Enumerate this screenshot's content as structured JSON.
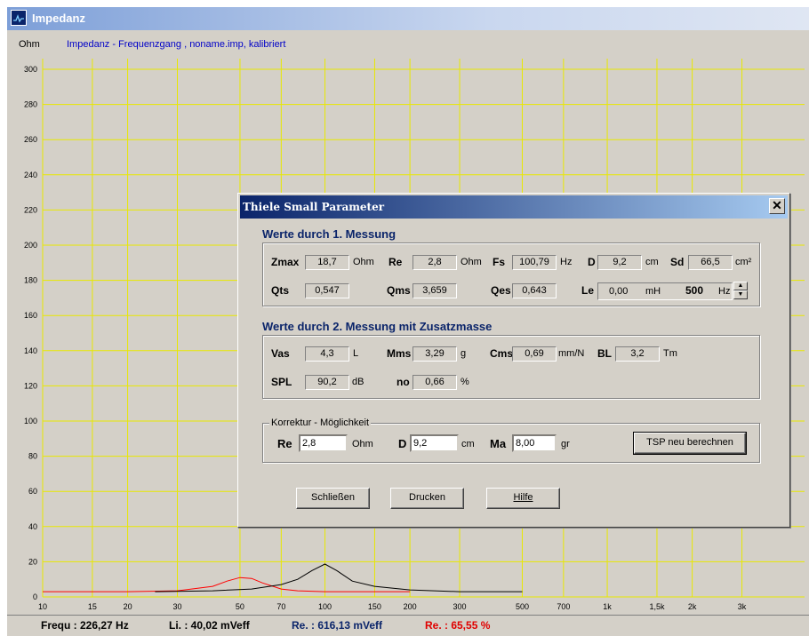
{
  "window": {
    "title": "Impedanz"
  },
  "chart_data": {
    "type": "line",
    "title": "Impedanz - Frequenzgang , noname.imp, kalibriert",
    "ylabel": "Ohm",
    "ylim": [
      0,
      300
    ],
    "xlim": [
      10,
      5000
    ],
    "x_scale": "log",
    "yticks": [
      0,
      20,
      40,
      60,
      80,
      100,
      120,
      140,
      160,
      180,
      200,
      220,
      240,
      260,
      280,
      300
    ],
    "xticks": [
      {
        "v": 10,
        "l": "10"
      },
      {
        "v": 15,
        "l": "15"
      },
      {
        "v": 20,
        "l": "20"
      },
      {
        "v": 30,
        "l": "30"
      },
      {
        "v": 50,
        "l": "50"
      },
      {
        "v": 70,
        "l": "70"
      },
      {
        "v": 100,
        "l": "100"
      },
      {
        "v": 150,
        "l": "150"
      },
      {
        "v": 200,
        "l": "200"
      },
      {
        "v": 300,
        "l": "300"
      },
      {
        "v": 500,
        "l": "500"
      },
      {
        "v": 700,
        "l": "700"
      },
      {
        "v": 1000,
        "l": "1k"
      },
      {
        "v": 1500,
        "l": "1,5k"
      },
      {
        "v": 2000,
        "l": "2k"
      },
      {
        "v": 3000,
        "l": "3k"
      }
    ],
    "grid": true,
    "colors": {
      "grid": "#e8e800",
      "background": "#d4d0c8"
    },
    "series": [
      {
        "color": "#ff0000",
        "x": [
          10,
          20,
          30,
          40,
          45,
          50,
          55,
          60,
          70,
          80,
          100,
          130,
          160,
          200
        ],
        "y": [
          3,
          3,
          3.5,
          6,
          9,
          11,
          10.5,
          8,
          4.5,
          3.5,
          3,
          3,
          3,
          3
        ]
      },
      {
        "color": "#000000",
        "x": [
          25,
          40,
          55,
          70,
          80,
          90,
          100,
          110,
          125,
          150,
          200,
          300,
          500
        ],
        "y": [
          3,
          3.5,
          4.5,
          7,
          10,
          15,
          18.7,
          15,
          9,
          6,
          4,
          3,
          3
        ]
      }
    ]
  },
  "dialog": {
    "title": "Thiele Small Parameter",
    "close_label": "✕",
    "section1": "Werte durch 1. Messung",
    "section2": "Werte durch 2. Messung mit Zusatzmasse",
    "m1": {
      "zmax": {
        "label": "Zmax",
        "value": "18,7",
        "unit": "Ohm"
      },
      "re": {
        "label": "Re",
        "value": "2,8",
        "unit": "Ohm"
      },
      "fs": {
        "label": "Fs",
        "value": "100,79",
        "unit": "Hz"
      },
      "d": {
        "label": "D",
        "value": "9,2",
        "unit": "cm"
      },
      "sd": {
        "label": "Sd",
        "value": "66,5",
        "unit": "cm²"
      },
      "qts": {
        "label": "Qts",
        "value": "0,547"
      },
      "qms": {
        "label": "Qms",
        "value": "3,659"
      },
      "qes": {
        "label": "Qes",
        "value": "0,643"
      },
      "le": {
        "label": "Le",
        "value": "0,00",
        "unit": "mH",
        "freq": "500",
        "freq_unit": "Hz"
      }
    },
    "m2": {
      "vas": {
        "label": "Vas",
        "value": "4,3",
        "unit": "L"
      },
      "mms": {
        "label": "Mms",
        "value": "3,29",
        "unit": "g"
      },
      "cms": {
        "label": "Cms",
        "value": "0,69",
        "unit": "mm/N"
      },
      "bl": {
        "label": "BL",
        "value": "3,2",
        "unit": "Tm"
      },
      "spl": {
        "label": "SPL",
        "value": "90,2",
        "unit": "dB"
      },
      "no": {
        "label": "no",
        "value": "0,66",
        "unit": "%"
      }
    },
    "korrektur": {
      "title": "Korrektur - Möglichkeit",
      "re": {
        "label": "Re",
        "value": "2,8",
        "unit": "Ohm"
      },
      "d": {
        "label": "D",
        "value": "9,2",
        "unit": "cm"
      },
      "ma": {
        "label": "Ma",
        "value": "8,00",
        "unit": "gr"
      },
      "recalc_label": "TSP neu berechnen"
    },
    "buttons": {
      "close": "Schließen",
      "print": "Drucken",
      "help": "Hilfe"
    }
  },
  "status": {
    "frequ": "Frequ : 226,27 Hz",
    "li": "Li. : 40,02 mVeff",
    "re_mveff": "Re. : 616,13 mVeff",
    "re_pct": "Re. : 65,55 %"
  }
}
